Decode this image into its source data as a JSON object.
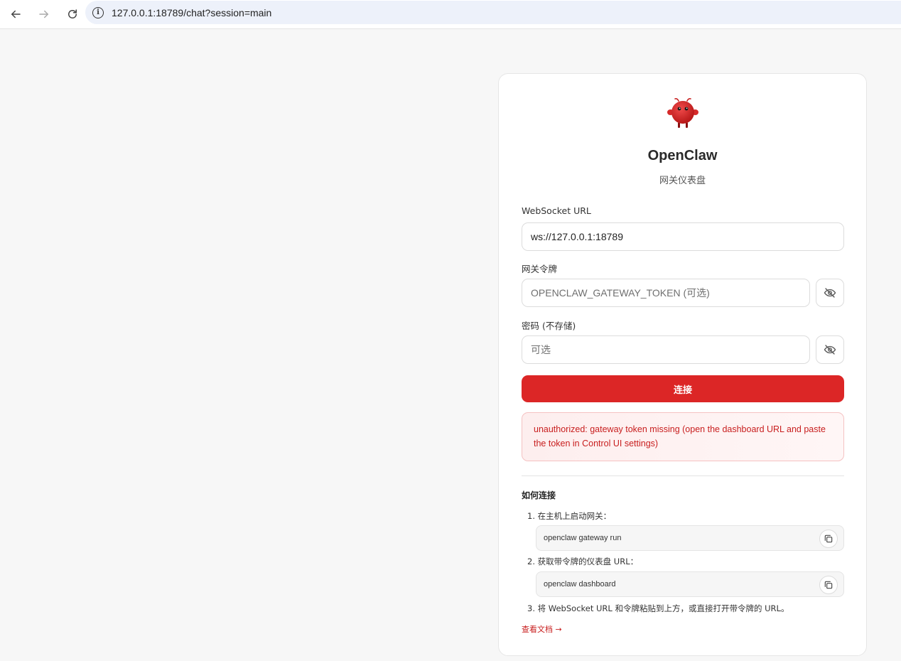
{
  "browser": {
    "url": "127.0.0.1:18789/chat?session=main"
  },
  "app": {
    "title": "OpenClaw",
    "subtitle": "网关仪表盘",
    "brand_color": "#dc2626"
  },
  "form": {
    "websocket_label": "WebSocket URL",
    "websocket_value": "ws://127.0.0.1:18789",
    "token_label": "网关令牌",
    "token_placeholder": "OPENCLAW_GATEWAY_TOKEN (可选)",
    "password_label": "密码 (不存储)",
    "password_placeholder": "可选",
    "connect_label": "连接"
  },
  "error": {
    "message": "unauthorized: gateway token missing (open the dashboard URL and paste the token in Control UI settings)"
  },
  "howto": {
    "title": "如何连接",
    "steps": [
      {
        "text": "1. 在主机上启动网关：",
        "code": "openclaw gateway run"
      },
      {
        "text": "2. 获取带令牌的仪表盘 URL：",
        "code": "openclaw dashboard"
      },
      {
        "text": "3. 将 WebSocket URL 和令牌粘贴到上方，或直接打开带令牌的 URL。"
      }
    ],
    "docs_link": "查看文档 →"
  },
  "icons": {
    "back": "arrow-left-icon",
    "forward": "arrow-right-icon",
    "reload": "reload-icon",
    "info": "info-icon",
    "eye_off": "eye-off-icon",
    "copy": "copy-icon",
    "logo": "lobster-mascot-icon"
  }
}
